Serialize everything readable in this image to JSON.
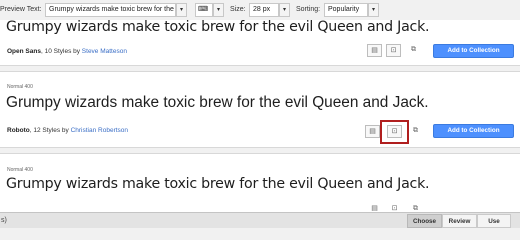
{
  "toolbar": {
    "preview_label": "Preview Text:",
    "preview_value": "Grumpy wizards make toxic brew for the e",
    "size_label": "Size:",
    "size_value": "28 px",
    "sorting_label": "Sorting:",
    "sorting_value": "Popularity",
    "keyboard_icon": "keyboard-icon",
    "dropdown_icon": "chevron-down-icon"
  },
  "cards": [
    {
      "sample_text": "Grumpy wizards make toxic brew for the evil Queen and Jack.",
      "font_name": "Open Sans",
      "styles_text": ", 10 Styles by ",
      "designer": "Steve Matteson",
      "add_label": "Add to Collection"
    },
    {
      "style_label": "Normal 400",
      "sample_text": "Grumpy wizards make toxic brew for the evil Queen and Jack.",
      "font_name": "Roboto",
      "styles_text": ", 12 Styles by ",
      "designer": "Christian Robertson",
      "add_label": "Add to Collection"
    },
    {
      "style_label": "Normal 400",
      "sample_text": "Grumpy wizards make toxic brew for the evil Queen and Jack."
    }
  ],
  "icons": {
    "details": "document-icon",
    "quick_use": "arrow-box-icon",
    "pop_out": "pop-out-icon"
  },
  "bottom": {
    "left_text": "s)",
    "tabs": [
      "Choose",
      "Review",
      "Use"
    ]
  },
  "colors": {
    "accent": "#4d90fe",
    "link": "#3a6ec6",
    "highlight": "#b01e1e"
  }
}
